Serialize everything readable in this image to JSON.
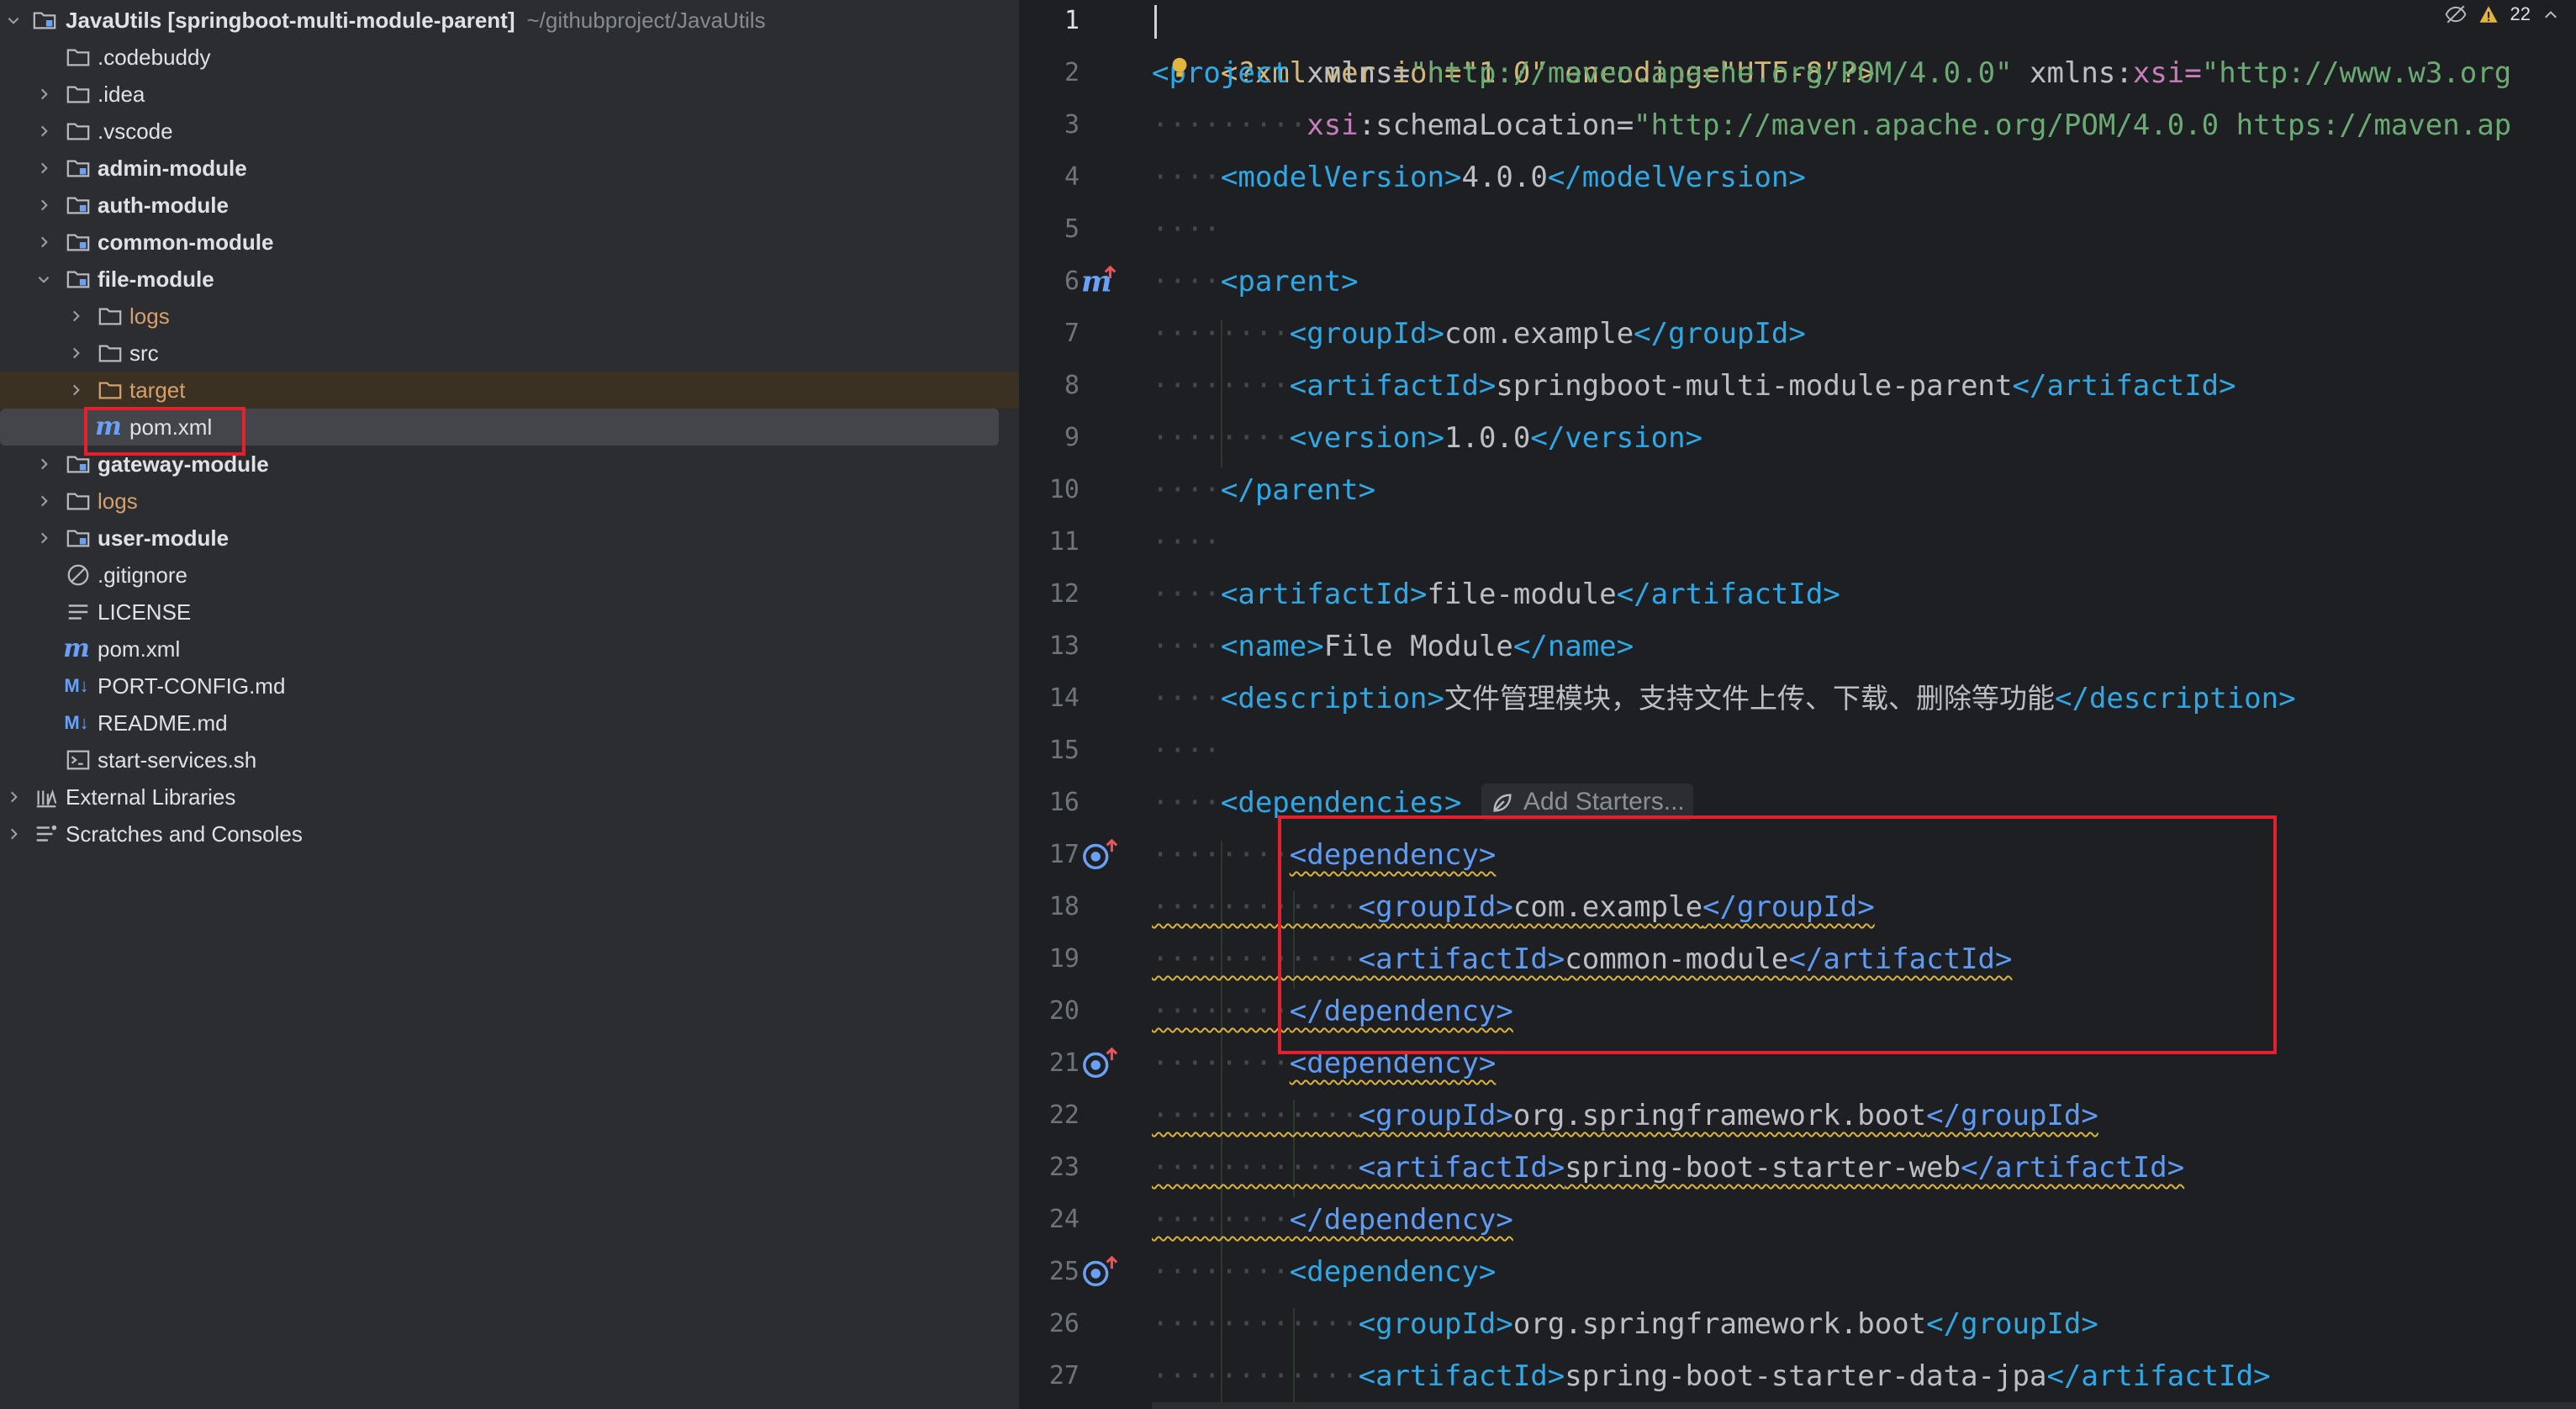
{
  "tree": {
    "root_name": "JavaUtils",
    "root_module": "[springboot-multi-module-parent]",
    "root_path": "~/githubproject/JavaUtils",
    "items": [
      {
        "label": ".codebuddy"
      },
      {
        "label": ".idea"
      },
      {
        "label": ".vscode"
      },
      {
        "label": "admin-module"
      },
      {
        "label": "auth-module"
      },
      {
        "label": "common-module"
      },
      {
        "label": "file-module"
      },
      {
        "label": "logs"
      },
      {
        "label": "src"
      },
      {
        "label": "target"
      },
      {
        "label": "pom.xml"
      },
      {
        "label": "gateway-module"
      },
      {
        "label": "logs"
      },
      {
        "label": "user-module"
      },
      {
        "label": ".gitignore"
      },
      {
        "label": "LICENSE"
      },
      {
        "label": "pom.xml"
      },
      {
        "label": "PORT-CONFIG.md"
      },
      {
        "label": "README.md"
      },
      {
        "label": "start-services.sh"
      },
      {
        "label": "External Libraries"
      },
      {
        "label": "Scratches and Consoles"
      }
    ]
  },
  "editor": {
    "warning_count": "22",
    "hint_add_starters": "Add Starters...",
    "line_numbers": [
      "1",
      "2",
      "3",
      "4",
      "5",
      "6",
      "7",
      "8",
      "9",
      "10",
      "11",
      "12",
      "13",
      "14",
      "15",
      "16",
      "17",
      "18",
      "19",
      "20",
      "21",
      "22",
      "23",
      "24",
      "25",
      "26",
      "27"
    ],
    "code": {
      "l1_decl": "<?xml version=\"1.0\" encoding=\"UTF-8\"?>",
      "l2_tag": "<project",
      "l2_attr1": "xmlns=",
      "l2_val1": "\"http://maven.apache.org/POM/4.0.0\"",
      "l2_attr2ns": "xmlns:",
      "l2_attr2": "xsi=",
      "l2_val2": "\"http://www.w3.org",
      "l3_ns": "xsi",
      "l3_attr": ":schemaLocation=",
      "l3_val": "\"http://maven.apache.org/POM/4.0.0 https://maven.ap",
      "l4_open": "<modelVersion>",
      "l4_text": "4.0.0",
      "l4_close": "</modelVersion>",
      "l6": "<parent>",
      "l7_open": "<groupId>",
      "l7_text": "com.example",
      "l7_close": "</groupId>",
      "l8_open": "<artifactId>",
      "l8_text": "springboot-multi-module-parent",
      "l8_close": "</artifactId>",
      "l9_open": "<version>",
      "l9_text": "1.0.0",
      "l9_close": "</version>",
      "l10": "</parent>",
      "l12_open": "<artifactId>",
      "l12_text": "file-module",
      "l12_close": "</artifactId>",
      "l13_open": "<name>",
      "l13_text": "File Module",
      "l13_close": "</name>",
      "l14_open": "<description>",
      "l14_text": "文件管理模块，支持文件上传、下载、删除等功能",
      "l14_close": "</description>",
      "l16": "<dependencies>",
      "l17": "<dependency>",
      "l18_open": "<groupId>",
      "l18_text": "com.example",
      "l18_close": "</groupId>",
      "l19_open": "<artifactId>",
      "l19_text": "common-module",
      "l19_close": "</artifactId>",
      "l20": "</dependency>",
      "l21": "<dependency>",
      "l22_open": "<groupId>",
      "l22_text": "org.springframework.boot",
      "l22_close": "</groupId>",
      "l23_open": "<artifactId>",
      "l23_text": "spring-boot-starter-web",
      "l23_close": "</artifactId>",
      "l24": "</dependency>",
      "l25": "<dependency>",
      "l26_open": "<groupId>",
      "l26_text": "org.springframework.boot",
      "l26_close": "</groupId>",
      "l27_open": "<artifactId>",
      "l27_text": "spring-boot-starter-data-jpa",
      "l27_close": "</artifactId>"
    }
  },
  "colors": {
    "tree_bg": "#2b2d30",
    "editor_bg": "#1e1f22",
    "highlight_red": "#e5202d",
    "tag": "#2fa8e5",
    "string": "#6aab73",
    "folder_excluded": "#d5a06c",
    "maven_icon": "#6aa0f5"
  },
  "icons": [
    "folder-icon",
    "module-folder-icon",
    "maven-file-icon",
    "markdown-icon",
    "ignore-file-icon",
    "text-file-icon",
    "shell-script-icon",
    "library-icon",
    "scratches-icon",
    "chevron-right-icon",
    "chevron-down-icon",
    "maven-gutter-icon",
    "spring-bean-gutter-icon",
    "bulb-icon",
    "spring-leaf-icon",
    "warning-icon",
    "eye-off-icon"
  ]
}
